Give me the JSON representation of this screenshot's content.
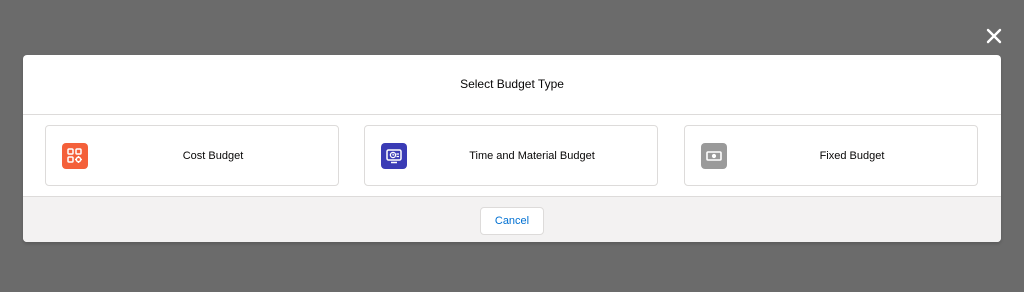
{
  "modal": {
    "title": "Select Budget Type",
    "close_icon": "close-icon",
    "options": [
      {
        "label": "Cost Budget",
        "icon": "cost-budget-icon",
        "color": "#f4603a"
      },
      {
        "label": "Time and Material Budget",
        "icon": "time-material-icon",
        "color": "#3a3bb5"
      },
      {
        "label": "Fixed Budget",
        "icon": "fixed-budget-icon",
        "color": "#9a9a9a"
      }
    ],
    "cancel_label": "Cancel"
  },
  "colors": {
    "backdrop": "#6b6b6b",
    "link_blue": "#0070d2",
    "footer_bg": "#f3f2f2"
  }
}
